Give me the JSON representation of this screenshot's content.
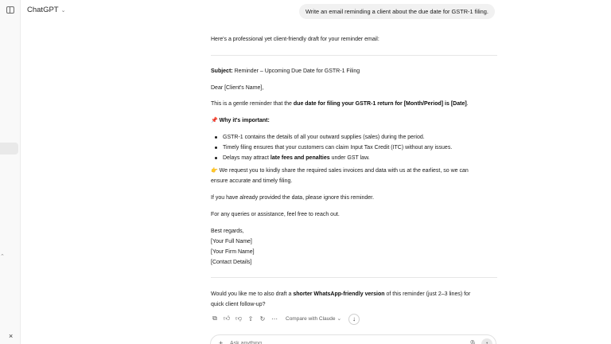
{
  "header": {
    "model_name": "ChatGPT",
    "chevron_icon": "chevron-down-icon"
  },
  "user_message": "Write an email reminding a client about the due date for GSTR-1 filing.",
  "response": {
    "intro": "Here's a professional yet client-friendly draft for your reminder email:",
    "subject_label": "Subject:",
    "subject_text": "Reminder – Upcoming Due Date for GSTR-1 Filing",
    "greeting": "Dear [Client's Name],",
    "para1_pre": "This is a gentle reminder that the ",
    "para1_bold": "due date for filing your GSTR-1 return for [Month/Period] is [Date]",
    "para1_post": ".",
    "why_emoji": "📌",
    "why_heading": "Why it's important:",
    "bullet1": "GSTR-1 contains the details of all your outward supplies (sales) during the period.",
    "bullet2": "Timely filing ensures that your customers can claim Input Tax Credit (ITC) without any issues.",
    "bullet3_pre": "Delays may attract ",
    "bullet3_bold": "late fees and penalties",
    "bullet3_post": " under GST law.",
    "request_emoji": "👉",
    "request_line1": " We request you to kindly share the required sales invoices and data with us at the earliest, so we can",
    "request_line2": "ensure accurate and timely filing.",
    "already": "If you have already provided the data, please ignore this reminder.",
    "queries": "For any queries or assistance, feel free to reach out.",
    "signoff": "Best regards,",
    "sig1": "[Your Full Name]",
    "sig2": "[Your Firm Name]",
    "sig3": "[Contact Details]",
    "followup_pre": "Would you like me to also draft a ",
    "followup_bold": "shorter WhatsApp-friendly version",
    "followup_post": " of this reminder (just 2–3 lines) for",
    "followup_line2": "quick client follow-up?"
  },
  "actions": {
    "compare_label": "Compare with Claude",
    "icons": [
      "copy-icon",
      "thumbs-up-icon",
      "thumbs-down-icon",
      "share-icon",
      "regenerate-icon",
      "more-icon"
    ]
  },
  "composer": {
    "placeholder": "Ask anything"
  },
  "sidebar": {
    "close_glyph": "×"
  }
}
